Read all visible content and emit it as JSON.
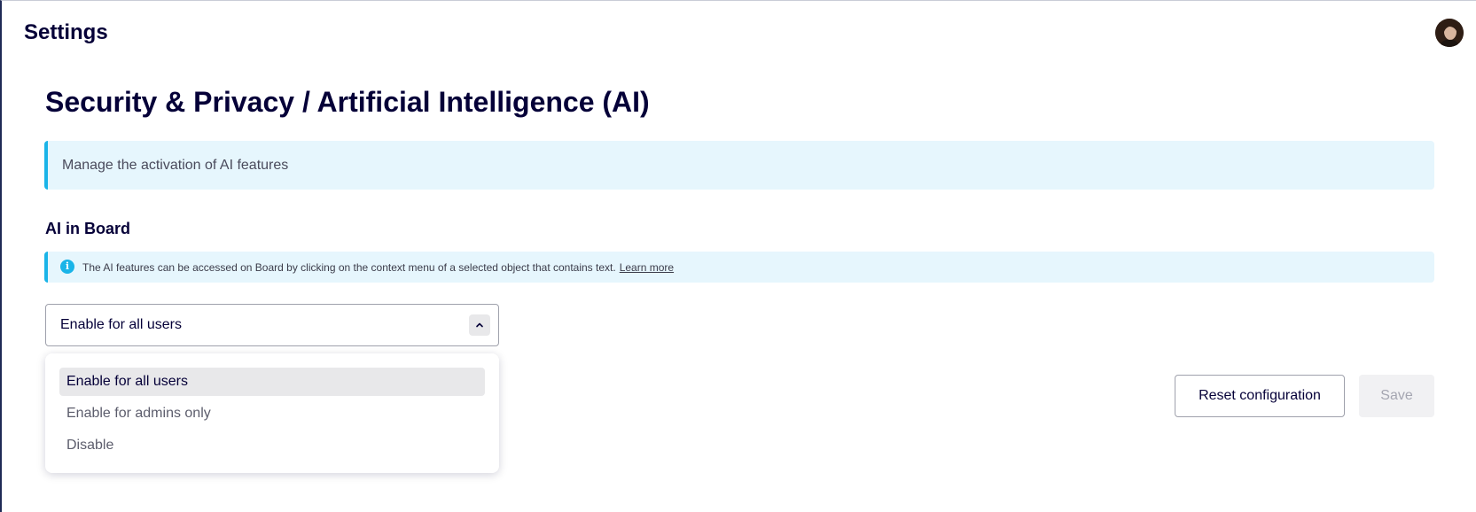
{
  "header": {
    "title": "Settings",
    "avatar_icon": "user-avatar"
  },
  "page": {
    "title": "Security & Privacy / Artificial Intelligence (AI)",
    "banner_text": "Manage the activation of AI features"
  },
  "section": {
    "title": "AI in Board",
    "info_icon": "info-icon",
    "info_text": "The AI features can be accessed on Board by clicking on the context menu of a selected object that contains text.",
    "info_link": "Learn more"
  },
  "select": {
    "value": "Enable for all users",
    "chevron_icon": "chevron-up-icon",
    "options": [
      {
        "label": "Enable for all users",
        "selected": true
      },
      {
        "label": "Enable for admins only",
        "selected": false
      },
      {
        "label": "Disable",
        "selected": false
      }
    ]
  },
  "actions": {
    "reset_label": "Reset configuration",
    "save_label": "Save"
  },
  "colors": {
    "accent": "#1ab4e8",
    "banner_bg": "#e6f6fd",
    "text": "#050038"
  }
}
